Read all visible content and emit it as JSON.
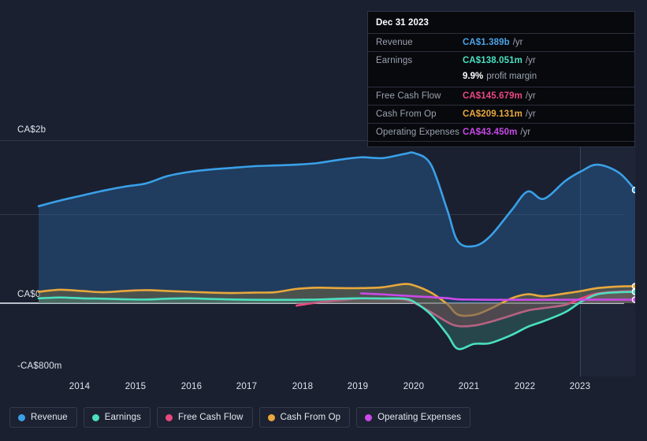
{
  "theme": {
    "background": "#1a2030",
    "plot_background": "#141a28",
    "gridline": "#32384a",
    "zeroline": "#b9c0cc",
    "text": "#e9edf2",
    "muted_text": "#9aa2b1"
  },
  "tooltip": {
    "date": "Dec 31 2023",
    "rows": [
      {
        "label": "Revenue",
        "value": "CA$1.389b",
        "unit": "/yr",
        "color": "#4aa3e8"
      },
      {
        "label": "Earnings",
        "value": "CA$138.051m",
        "unit": "/yr",
        "color": "#4ae0c0"
      },
      {
        "label": "Free Cash Flow",
        "value": "CA$145.679m",
        "unit": "/yr",
        "color": "#e8487f"
      },
      {
        "label": "Cash From Op",
        "value": "CA$209.131m",
        "unit": "/yr",
        "color": "#e8a83d"
      },
      {
        "label": "Operating Expenses",
        "value": "CA$43.450m",
        "unit": "/yr",
        "color": "#c84ae8"
      }
    ],
    "margin_value": "9.9%",
    "margin_label": "profit margin"
  },
  "legend": {
    "items": [
      {
        "label": "Revenue",
        "color": "#3aa0e8"
      },
      {
        "label": "Earnings",
        "color": "#4ae0c0"
      },
      {
        "label": "Free Cash Flow",
        "color": "#e8487f"
      },
      {
        "label": "Cash From Op",
        "color": "#e8a83d"
      },
      {
        "label": "Operating Expenses",
        "color": "#c84ae8"
      }
    ]
  },
  "axes": {
    "y_labels": [
      {
        "text": "CA$2b",
        "value": 2000,
        "y": 178
      },
      {
        "text": "CA$0",
        "value": 0,
        "y": 385
      },
      {
        "text": "-CA$800m",
        "value": -800,
        "y": 478
      }
    ],
    "x_labels": [
      "2014",
      "2015",
      "2016",
      "2017",
      "2018",
      "2019",
      "2020",
      "2021",
      "2022",
      "2023"
    ]
  },
  "chart_data": {
    "type": "area",
    "title": "",
    "xlabel": "",
    "ylabel": "CA$",
    "currency": "CA$",
    "units": "millions",
    "ylim": [
      -800,
      2100
    ],
    "xlim": [
      2013.2,
      2024.3
    ],
    "grid": true,
    "legend_position": "bottom-left",
    "gridlines": [
      2000,
      1000,
      0
    ],
    "forecast_start": 2023.55,
    "annotations": [
      "forecast shading to the right of 2023.55"
    ],
    "x": [
      2013.2,
      2013.6,
      2014.0,
      2014.4,
      2014.8,
      2015.2,
      2015.6,
      2016.0,
      2016.4,
      2016.8,
      2017.2,
      2017.6,
      2018.0,
      2018.4,
      2018.8,
      2019.2,
      2019.6,
      2020.0,
      2020.2,
      2020.5,
      2020.8,
      2021.0,
      2021.3,
      2021.6,
      2022.0,
      2022.3,
      2022.6,
      2023.0,
      2023.3,
      2023.6,
      2024.0,
      2024.3
    ],
    "series": [
      {
        "name": "Revenue",
        "color": "#3aa0e8",
        "fill": "rgba(40,95,150,0.45)",
        "end_label": "CA$1.389b",
        "values": [
          1190,
          1260,
          1320,
          1380,
          1430,
          1470,
          1560,
          1610,
          1640,
          1660,
          1680,
          1690,
          1700,
          1720,
          1760,
          1790,
          1780,
          1830,
          1840,
          1700,
          1150,
          760,
          700,
          820,
          1140,
          1370,
          1280,
          1500,
          1620,
          1700,
          1600,
          1389
        ]
      },
      {
        "name": "Earnings",
        "color": "#4ae0c0",
        "fill": "rgba(70,160,140,0.30)",
        "end_label": "CA$138.051m",
        "values": [
          60,
          70,
          60,
          55,
          48,
          45,
          55,
          60,
          52,
          45,
          42,
          40,
          42,
          45,
          55,
          60,
          58,
          55,
          10,
          -140,
          -380,
          -560,
          -500,
          -490,
          -390,
          -290,
          -220,
          -110,
          20,
          110,
          135,
          138
        ]
      },
      {
        "name": "Free Cash Flow",
        "color": "#e8487f",
        "fill": "rgba(150,40,60,0.45)",
        "start_x": 2018.0,
        "end_label": "CA$145.679m",
        "values": [
          null,
          null,
          null,
          null,
          null,
          null,
          null,
          null,
          null,
          null,
          null,
          null,
          -30,
          10,
          35,
          60,
          55,
          45,
          0,
          -110,
          -230,
          -280,
          -275,
          -230,
          -150,
          -90,
          -60,
          -20,
          60,
          120,
          142,
          146
        ]
      },
      {
        "name": "Cash From Op",
        "color": "#e8a83d",
        "fill": "rgba(140,115,55,0.40)",
        "end_label": "CA$209.131m",
        "values": [
          140,
          165,
          150,
          135,
          150,
          160,
          150,
          140,
          130,
          125,
          130,
          135,
          175,
          190,
          185,
          185,
          195,
          235,
          215,
          130,
          -10,
          -140,
          -145,
          -70,
          60,
          110,
          85,
          120,
          150,
          185,
          205,
          209
        ]
      },
      {
        "name": "Operating Expenses",
        "color": "#c84ae8",
        "fill": "none",
        "start_x": 2019.3,
        "end_label": "CA$43.450m",
        "values": [
          null,
          null,
          null,
          null,
          null,
          null,
          null,
          null,
          null,
          null,
          null,
          null,
          null,
          null,
          null,
          120,
          108,
          92,
          84,
          74,
          62,
          48,
          44,
          42,
          42,
          42,
          42,
          42,
          43,
          43,
          43,
          43
        ]
      }
    ]
  }
}
